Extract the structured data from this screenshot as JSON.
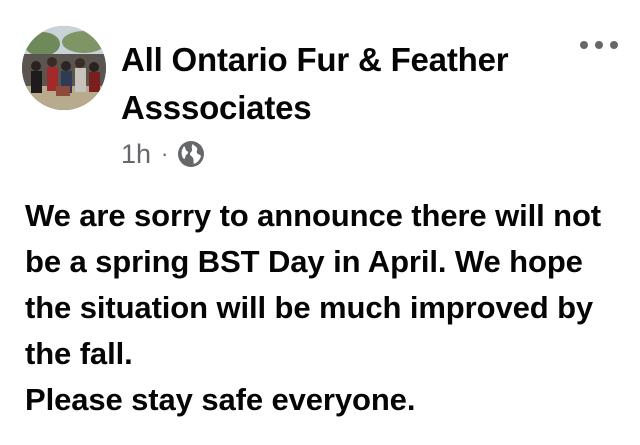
{
  "post": {
    "author": {
      "name": "All Ontario Fur & Feather Asssociates",
      "avatar_icon": "crowd-photo-avatar"
    },
    "meta": {
      "time": "1h",
      "separator": "·",
      "privacy_icon": "globe-icon"
    },
    "more_icon": "more-horizontal-icon",
    "body": "We are sorry to announce there will not be a spring BST Day in April.   We hope the situation will be much improved by the fall.\nPlease stay safe everyone."
  },
  "colors": {
    "text": "#050505",
    "meta_text": "#65676b",
    "background": "#ffffff"
  }
}
